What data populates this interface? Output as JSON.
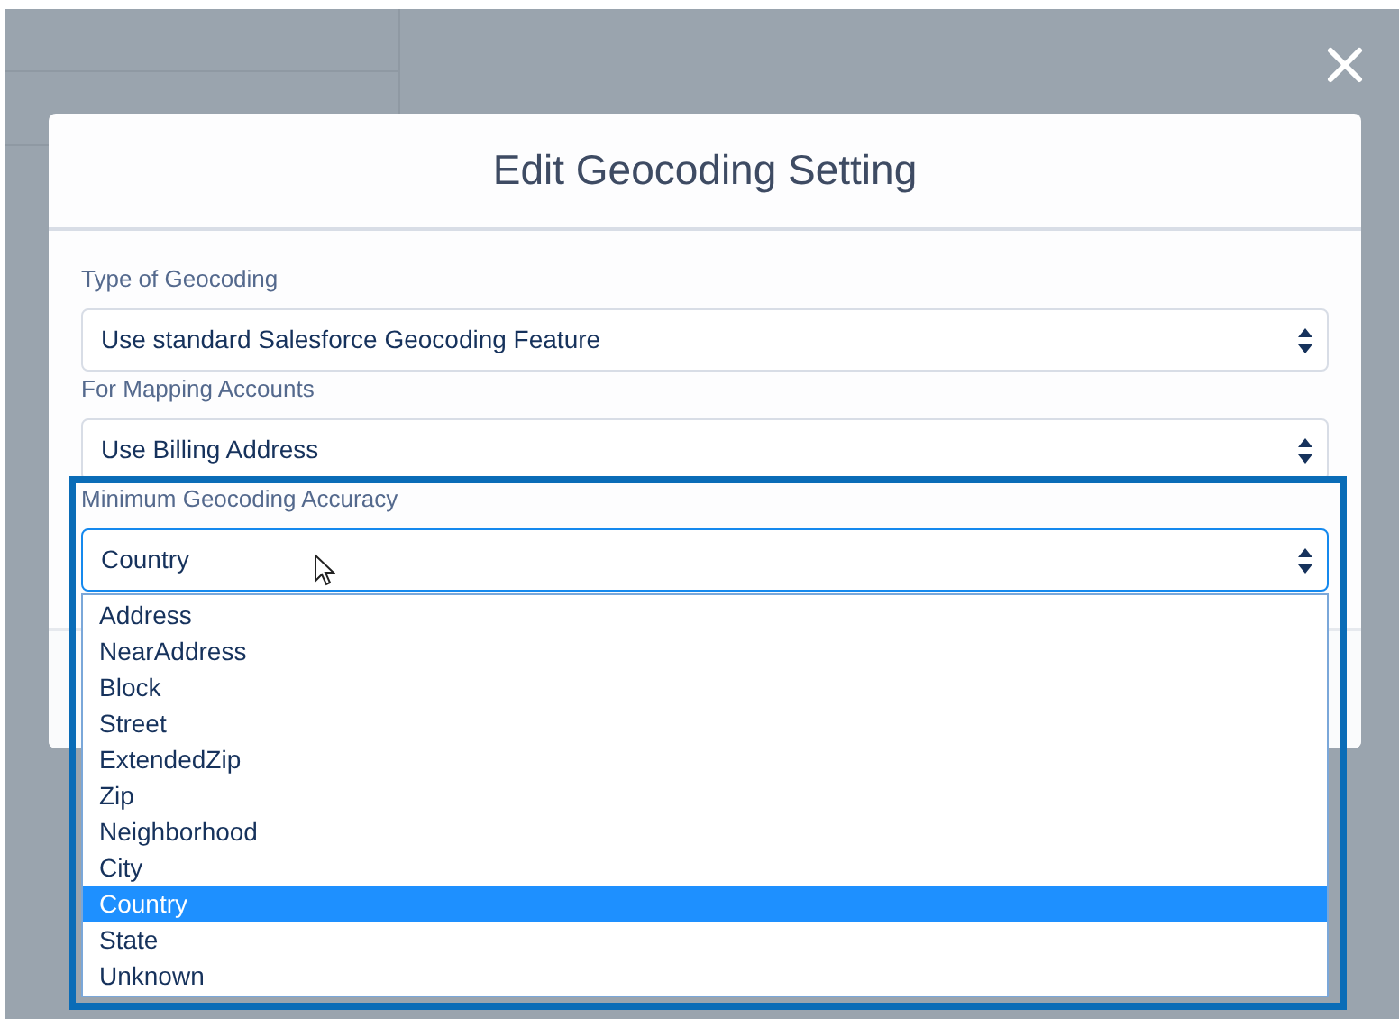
{
  "modal": {
    "title": "Edit Geocoding Setting"
  },
  "fields": [
    {
      "label": "Type of Geocoding",
      "value": "Use standard Salesforce Geocoding Feature",
      "focused": false
    },
    {
      "label": "For Mapping Accounts",
      "value": "Use Billing Address",
      "focused": false
    },
    {
      "label": "Minimum Geocoding Accuracy",
      "value": "Country",
      "focused": true,
      "highlighted": true,
      "options": [
        {
          "label": "Address",
          "selected": false
        },
        {
          "label": "NearAddress",
          "selected": false
        },
        {
          "label": "Block",
          "selected": false
        },
        {
          "label": "Street",
          "selected": false
        },
        {
          "label": "ExtendedZip",
          "selected": false
        },
        {
          "label": "Zip",
          "selected": false
        },
        {
          "label": "Neighborhood",
          "selected": false
        },
        {
          "label": "City",
          "selected": false
        },
        {
          "label": "Country",
          "selected": true
        },
        {
          "label": "State",
          "selected": false
        },
        {
          "label": "Unknown",
          "selected": false
        }
      ]
    }
  ]
}
